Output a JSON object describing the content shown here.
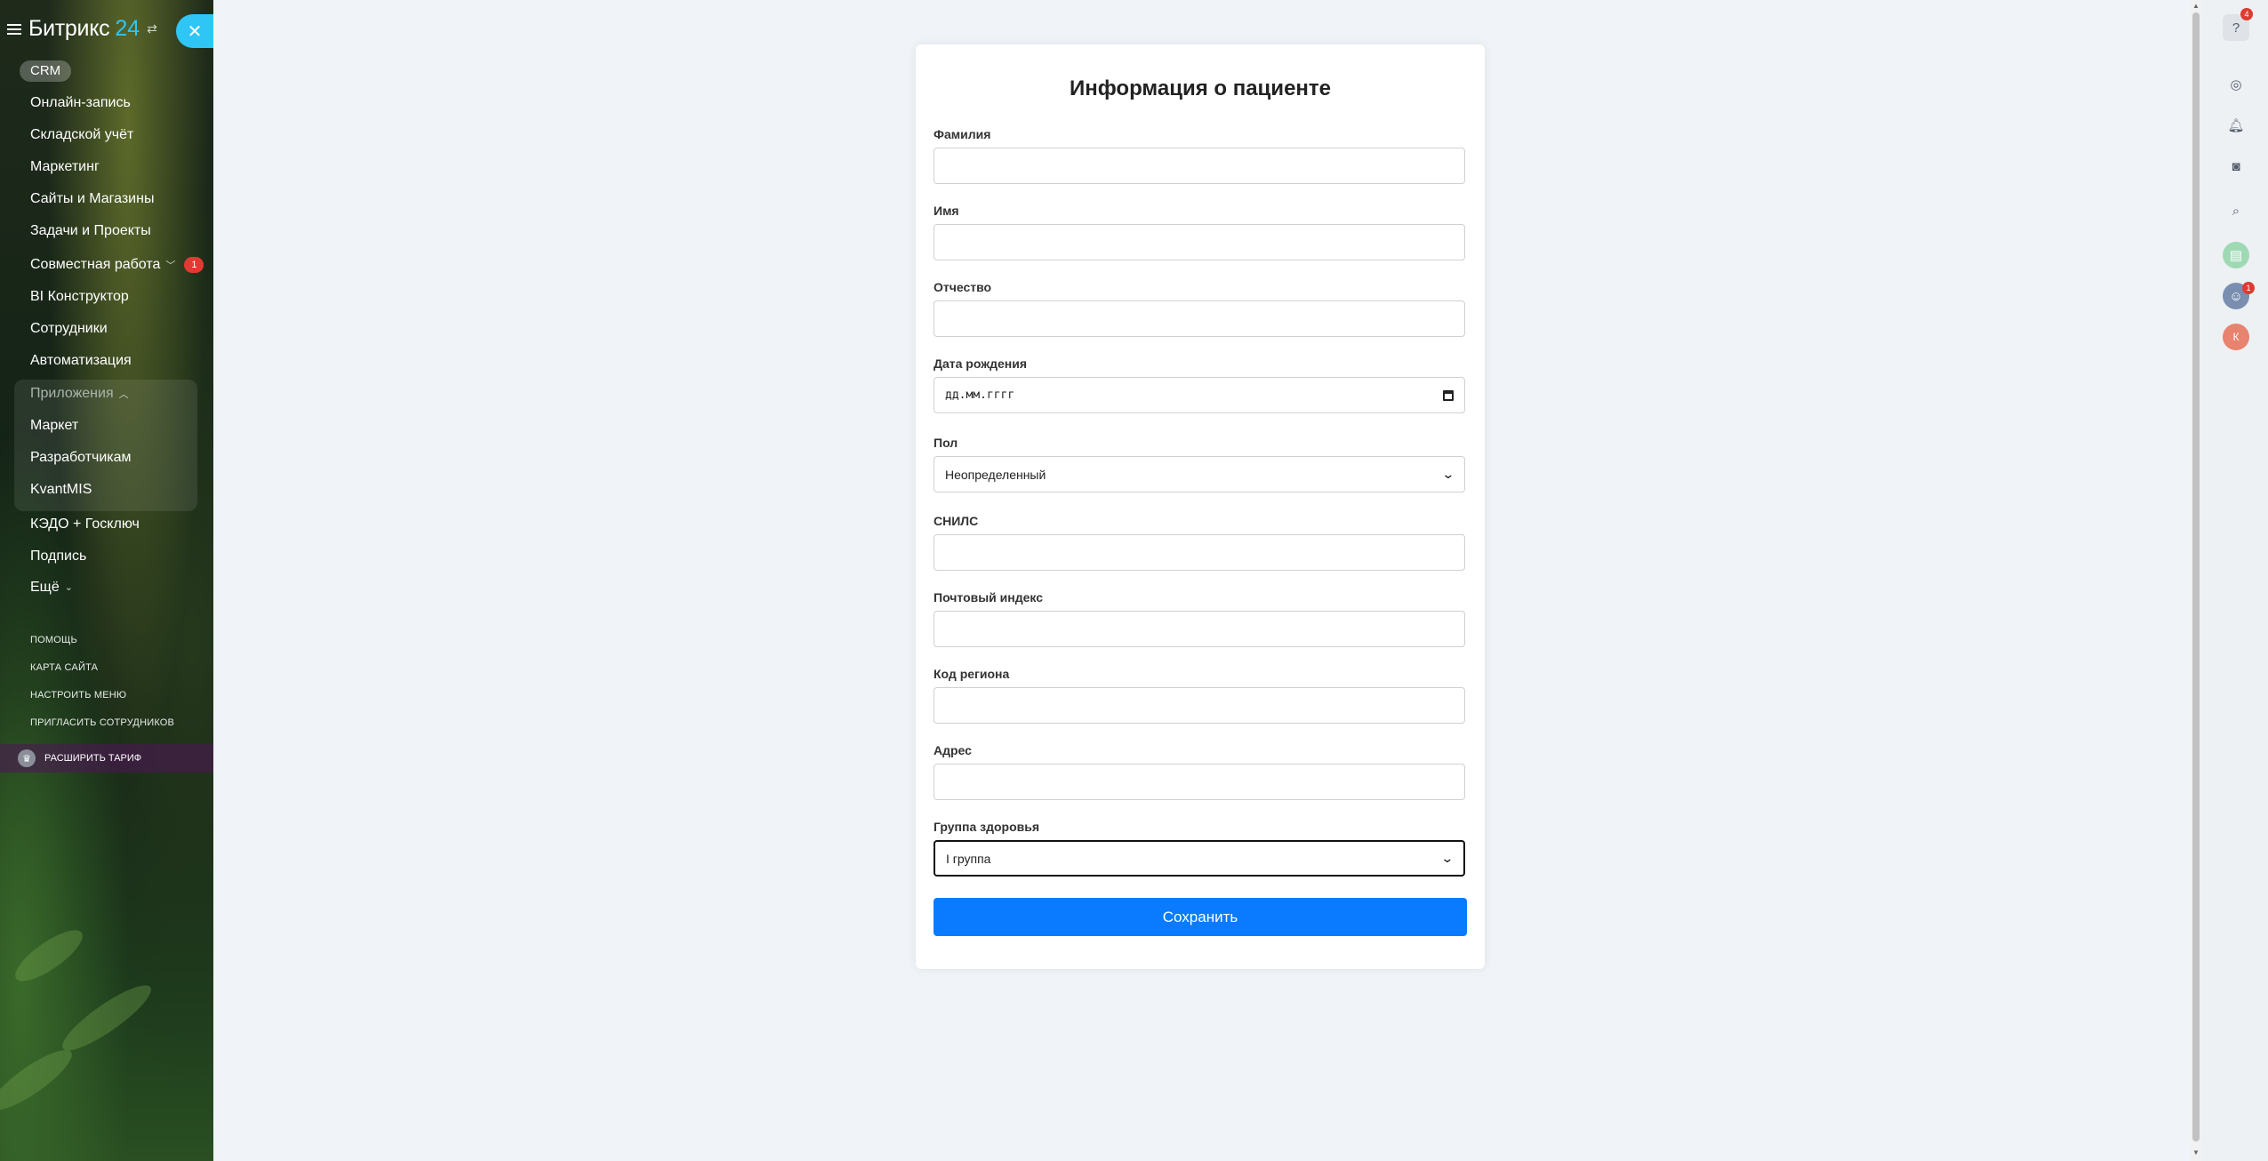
{
  "sidebar": {
    "brand": "Битрикс",
    "brand_num": "24",
    "crm_label": "CRM",
    "items": [
      {
        "label": "Онлайн-запись"
      },
      {
        "label": "Складской учёт"
      },
      {
        "label": "Маркетинг"
      },
      {
        "label": "Сайты и Магазины"
      },
      {
        "label": "Задачи и Проекты"
      },
      {
        "label": "Совместная работа",
        "badge": "1"
      },
      {
        "label": "BI Конструктор"
      },
      {
        "label": "Сотрудники"
      },
      {
        "label": "Автоматизация"
      }
    ],
    "apps_group": {
      "title": "Приложения",
      "items": [
        {
          "label": "Маркет"
        },
        {
          "label": "Разработчикам"
        },
        {
          "label": "KvantMIS"
        }
      ]
    },
    "items_after": [
      {
        "label": "КЭДО + Госключ"
      },
      {
        "label": "Подпись"
      },
      {
        "label": "Ещё"
      }
    ],
    "small_links": [
      {
        "label": "ПОМОЩЬ"
      },
      {
        "label": "КАРТА САЙТА"
      },
      {
        "label": "НАСТРОИТЬ МЕНЮ"
      },
      {
        "label": "ПРИГЛАСИТЬ СОТРУДНИКОВ"
      }
    ],
    "tariff_label": "РАСШИРИТЬ ТАРИФ"
  },
  "form": {
    "title": "Информация о пациенте",
    "fields": [
      {
        "label": "Фамилия",
        "value": ""
      },
      {
        "label": "Имя",
        "value": ""
      },
      {
        "label": "Отчество",
        "value": ""
      },
      {
        "label": "Дата рождения",
        "value": "дд.мм.гггг"
      },
      {
        "label": "Пол",
        "value": "Неопределенный"
      },
      {
        "label": "СНИЛС",
        "value": ""
      },
      {
        "label": "Почтовый индекс",
        "value": ""
      },
      {
        "label": "Код региона",
        "value": ""
      },
      {
        "label": "Адрес",
        "value": ""
      },
      {
        "label": "Группа здоровья",
        "value": "I группа"
      }
    ],
    "save_label": "Сохранить"
  },
  "rail": {
    "help_badge": "4",
    "avatar_badge": "1",
    "user_initial": "К"
  },
  "colors": {
    "accent": "#2fc6f6",
    "save_button": "#0a7bff",
    "badge": "#e03a32"
  }
}
